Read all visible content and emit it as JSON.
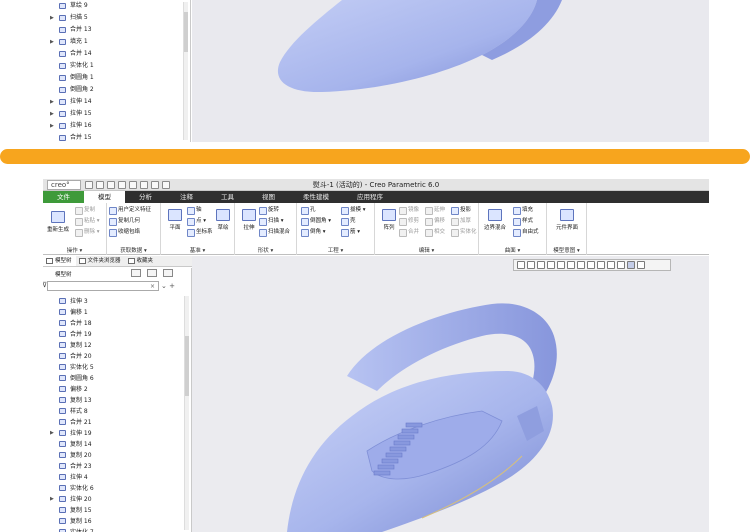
{
  "top_tree": {
    "items": [
      {
        "label": "草绘 9",
        "expand": false,
        "icon": "sketch-icon"
      },
      {
        "label": "扫描 5",
        "expand": true,
        "icon": "sweep-icon"
      },
      {
        "label": "合并 13",
        "expand": false,
        "icon": "merge-icon"
      },
      {
        "label": "填充 1",
        "expand": true,
        "icon": "fill-icon"
      },
      {
        "label": "合并 14",
        "expand": false,
        "icon": "merge-icon"
      },
      {
        "label": "实体化 1",
        "expand": false,
        "icon": "solidify-icon"
      },
      {
        "label": "倒圆角 1",
        "expand": false,
        "icon": "round-icon"
      },
      {
        "label": "倒圆角 2",
        "expand": false,
        "icon": "round-icon"
      },
      {
        "label": "拉伸 14",
        "expand": true,
        "icon": "extrude-icon"
      },
      {
        "label": "拉伸 15",
        "expand": true,
        "icon": "extrude-icon"
      },
      {
        "label": "拉伸 16",
        "expand": true,
        "icon": "extrude-icon"
      },
      {
        "label": "合并 15",
        "expand": false,
        "icon": "merge-icon"
      }
    ]
  },
  "window": {
    "logo": "creo°",
    "title": "熨斗-1 (活动的) - Creo Parametric 6.0"
  },
  "ribbon_tabs": [
    "文件",
    "模型",
    "分析",
    "注释",
    "工具",
    "视图",
    "柔性建模",
    "应用程序"
  ],
  "ribbon": {
    "operations": {
      "caption": "操作 ▾",
      "items": [
        "复制",
        "粘贴 ▾",
        "删除 ▾"
      ],
      "regen": "重新生成"
    },
    "get_data": {
      "caption": "获取数据 ▾",
      "items": [
        "用户定义特征",
        "复制几何",
        "收缩包络"
      ]
    },
    "datum": {
      "caption": "基准 ▾",
      "plane": "平面",
      "items": [
        "轴",
        "点 ▾",
        "坐标系"
      ],
      "sketch": "草绘"
    },
    "shapes": {
      "caption": "形状 ▾",
      "extrude": "拉伸",
      "items": [
        "旋转",
        "扫描 ▾",
        "扫描混合"
      ]
    },
    "engineering": {
      "caption": "工程 ▾",
      "items": [
        "孔",
        "倒圆角 ▾",
        "倒角 ▾",
        "拔模 ▾",
        "壳",
        "筋 ▾"
      ]
    },
    "editing": {
      "caption": "编辑 ▾",
      "pattern": "阵列",
      "items": [
        "镜像",
        "延伸",
        "投影",
        "修剪",
        "偏移",
        "加厚",
        "合并",
        "相交",
        "实体化"
      ]
    },
    "surfaces": {
      "caption": "曲面 ▾",
      "boundary": "边界混合",
      "items": [
        "填充",
        "样式",
        "自由式"
      ]
    },
    "intent": {
      "caption": "模型意图 ▾",
      "element": "元件界面"
    }
  },
  "panel_tabs": [
    "模型树",
    "文件夹浏览器",
    "收藏夹"
  ],
  "model_tree": {
    "header": "模型树",
    "filter_placeholder": "",
    "items": [
      {
        "label": "拉伸 3",
        "expand": false
      },
      {
        "label": "偏移 1",
        "expand": false
      },
      {
        "label": "合并 18",
        "expand": false
      },
      {
        "label": "合并 19",
        "expand": false
      },
      {
        "label": "复制 12",
        "expand": false
      },
      {
        "label": "合并 20",
        "expand": false
      },
      {
        "label": "实体化 5",
        "expand": false
      },
      {
        "label": "倒圆角 6",
        "expand": false
      },
      {
        "label": "偏移 2",
        "expand": false
      },
      {
        "label": "复制 13",
        "expand": false
      },
      {
        "label": "样式 8",
        "expand": false
      },
      {
        "label": "合并 21",
        "expand": false
      },
      {
        "label": "拉伸 19",
        "expand": true
      },
      {
        "label": "复制 14",
        "expand": false
      },
      {
        "label": "复制 20",
        "expand": false
      },
      {
        "label": "合并 23",
        "expand": false
      },
      {
        "label": "拉伸 4",
        "expand": false
      },
      {
        "label": "实体化 6",
        "expand": false
      },
      {
        "label": "拉伸 20",
        "expand": true
      },
      {
        "label": "复制 15",
        "expand": false
      },
      {
        "label": "复制 16",
        "expand": false
      },
      {
        "label": "实体化 7",
        "expand": false
      }
    ]
  },
  "colors": {
    "divider": "#f7a51e",
    "model_fill": "#a9b7ee",
    "model_shadow": "#7c8cd4",
    "ribbon_dark": "#2f2f2f",
    "file_tab": "#3e9a3a"
  }
}
